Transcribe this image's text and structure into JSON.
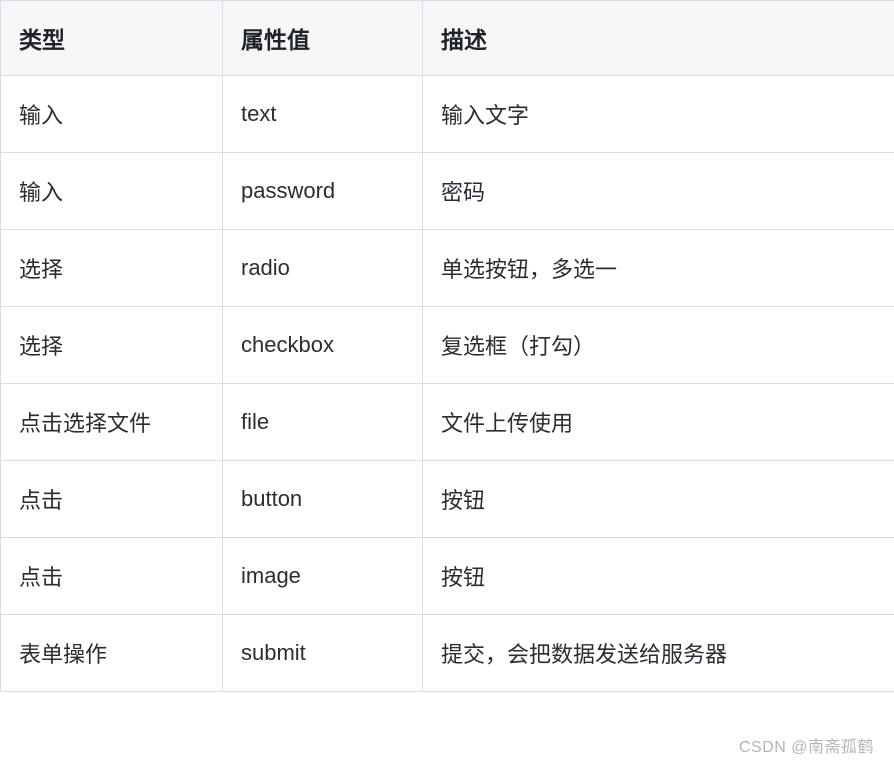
{
  "table": {
    "headers": [
      "类型",
      "属性值",
      "描述"
    ],
    "rows": [
      {
        "type": "输入",
        "attr": "text",
        "desc": "输入文字"
      },
      {
        "type": "输入",
        "attr": "password",
        "desc": "密码"
      },
      {
        "type": "选择",
        "attr": "radio",
        "desc": "单选按钮，多选一"
      },
      {
        "type": "选择",
        "attr": "checkbox",
        "desc": "复选框（打勾）"
      },
      {
        "type": "点击选择文件",
        "attr": "file",
        "desc": "文件上传使用"
      },
      {
        "type": "点击",
        "attr": "button",
        "desc": "按钮"
      },
      {
        "type": "点击",
        "attr": "image",
        "desc": "按钮"
      },
      {
        "type": "表单操作",
        "attr": "submit",
        "desc": "提交，会把数据发送给服务器"
      }
    ]
  },
  "watermark": "CSDN @南斋孤鹤"
}
